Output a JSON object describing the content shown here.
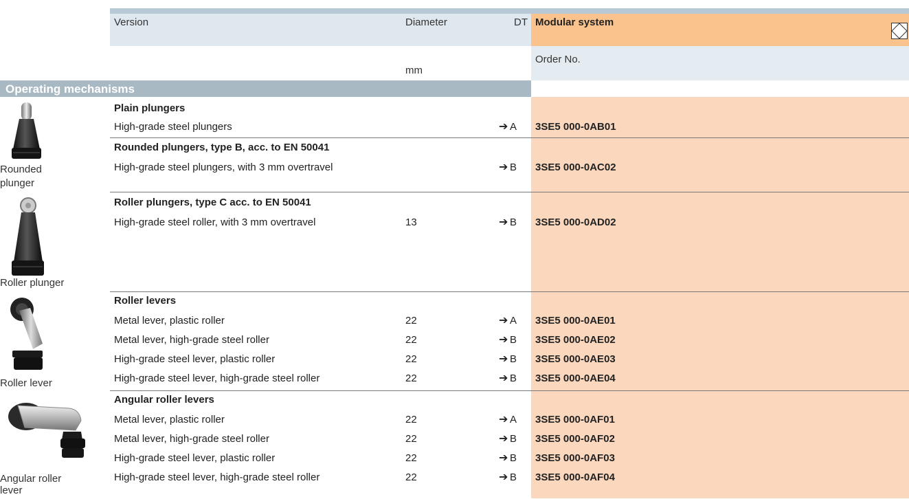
{
  "header": {
    "version": "Version",
    "diameter": "Diameter",
    "dt": "DT",
    "modular_system": "Modular system",
    "order_no": "Order No.",
    "mm": "mm"
  },
  "section": {
    "title": "Operating mechanisms"
  },
  "images": {
    "rounded_plunger": "Rounded plunger",
    "roller_plunger": "Roller plunger",
    "roller_lever": "Roller lever",
    "angular_roller_lever": "Angular roller lever"
  },
  "groups": [
    {
      "title": "Plain plungers",
      "rows": [
        {
          "version": "High-grade steel plungers",
          "diameter": "",
          "dt": "A",
          "order": "3SE5 000-0AB01"
        }
      ]
    },
    {
      "title": "Rounded plungers, type B, acc. to EN 50041",
      "rows": [
        {
          "version": "High-grade steel plungers, with 3 mm overtravel",
          "diameter": "",
          "dt": "B",
          "order": "3SE5 000-0AC02"
        }
      ]
    },
    {
      "title": "Roller plungers, type C acc. to EN 50041",
      "rows": [
        {
          "version": "High-grade steel roller, with 3 mm overtravel",
          "diameter": "13",
          "dt": "B",
          "order": "3SE5 000-0AD02"
        }
      ]
    },
    {
      "title": "Roller levers",
      "rows": [
        {
          "version": "Metal lever, plastic roller",
          "diameter": "22",
          "dt": "A",
          "order": "3SE5 000-0AE01"
        },
        {
          "version": "Metal lever, high-grade steel roller",
          "diameter": "22",
          "dt": "B",
          "order": "3SE5 000-0AE02"
        },
        {
          "version": "High-grade steel lever, plastic roller",
          "diameter": "22",
          "dt": "B",
          "order": "3SE5 000-0AE03"
        },
        {
          "version": "High-grade steel lever, high-grade steel roller",
          "diameter": "22",
          "dt": "B",
          "order": "3SE5 000-0AE04"
        }
      ]
    },
    {
      "title": "Angular roller levers",
      "rows": [
        {
          "version": "Metal lever, plastic roller",
          "diameter": "22",
          "dt": "A",
          "order": "3SE5 000-0AF01"
        },
        {
          "version": "Metal lever, high-grade steel roller",
          "diameter": "22",
          "dt": "B",
          "order": "3SE5 000-0AF02"
        },
        {
          "version": "High-grade steel lever, plastic roller",
          "diameter": "22",
          "dt": "B",
          "order": "3SE5 000-0AF03"
        },
        {
          "version": "High-grade steel lever, high-grade steel roller",
          "diameter": "22",
          "dt": "B",
          "order": "3SE5 000-0AF04"
        }
      ]
    }
  ],
  "colors": {
    "header_blue": "#dfe8ee",
    "header_orange": "#fac38d",
    "order_column": "#fbd8bd",
    "section_bar": "#a9b9c4"
  }
}
